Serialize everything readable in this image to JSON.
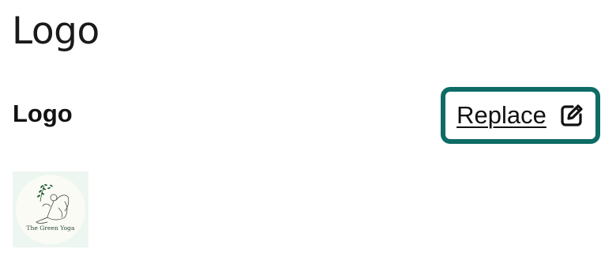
{
  "page": {
    "title": "Logo"
  },
  "section": {
    "label": "Logo",
    "replace_label": "Replace",
    "replace_icon": "edit-icon",
    "accent_color": "#0e6b66"
  },
  "logo": {
    "brand_text": "The Green Yoga",
    "background_color": "#edf6f1",
    "leaf_color": "#1f5a32"
  }
}
